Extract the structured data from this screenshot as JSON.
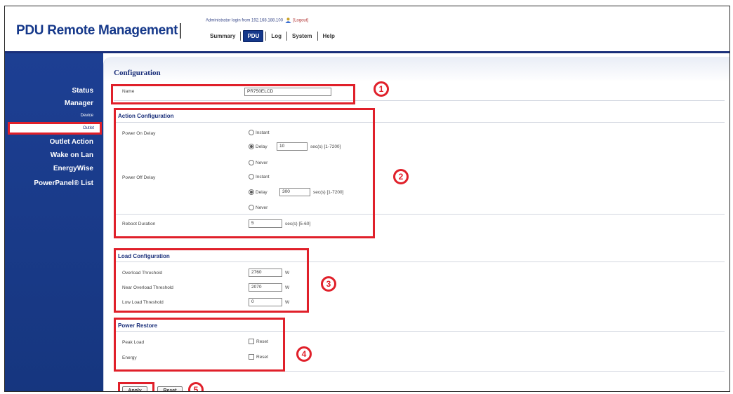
{
  "header": {
    "brand": "PDU Remote Management",
    "login_text": "Administrator login from 192.168.188.100",
    "logout_label": "[Logout]",
    "nav": [
      "Summary",
      "PDU",
      "Log",
      "System",
      "Help"
    ],
    "active_nav": "PDU"
  },
  "sidebar": {
    "status": "Status",
    "manager": "Manager",
    "device": "Device",
    "outlet": "Outlet",
    "outlet_action": "Outlet Action",
    "wake_on_lan": "Wake on Lan",
    "energywise": "EnergyWise",
    "powerpanel_list": "PowerPanel® List"
  },
  "page": {
    "title": "Configuration",
    "name_label": "Name",
    "name_value": "PR750ELCD"
  },
  "action_config": {
    "title": "Action Configuration",
    "power_on_delay_label": "Power On Delay",
    "power_off_delay_label": "Power Off Delay",
    "reboot_duration_label": "Reboot Duration",
    "opt_instant": "Instant",
    "opt_delay": "Delay",
    "opt_never": "Never",
    "on_delay_value": "10",
    "off_delay_value": "300",
    "delay_unit": "sec(s) [1-7200]",
    "reboot_value": "5",
    "reboot_unit": "sec(s) [5-60]"
  },
  "load_config": {
    "title": "Load Configuration",
    "overload_label": "Overload Threshold",
    "overload_value": "2760",
    "near_overload_label": "Near Overload Threshold",
    "near_overload_value": "2070",
    "low_load_label": "Low Load Threshold",
    "low_load_value": "0",
    "unit": "W"
  },
  "power_restore": {
    "title": "Power Restore",
    "peak_load_label": "Peak Load",
    "energy_label": "Energy",
    "reset_label": "Reset"
  },
  "buttons": {
    "apply": "Apply",
    "reset": "Reset"
  },
  "callouts": [
    "1",
    "2",
    "3",
    "4",
    "5"
  ],
  "colors": {
    "brand": "#15388a",
    "sidebar": "#1d3f93",
    "annotation": "#e0202a"
  }
}
